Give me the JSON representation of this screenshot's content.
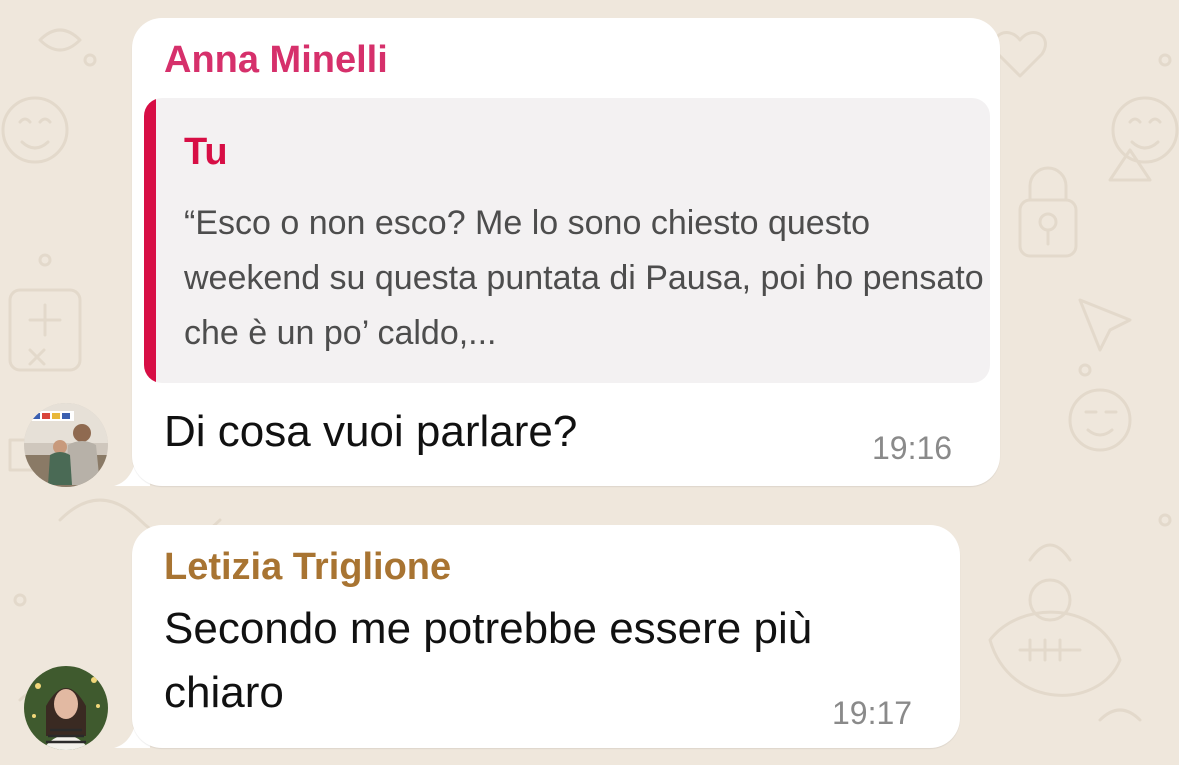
{
  "colors": {
    "background": "#efe7dc",
    "bubble": "#ffffff",
    "sender_anna": "#d6306b",
    "sender_letizia": "#a87432",
    "quote_accent": "#d70e45",
    "quote_background": "#f3f1f2",
    "timestamp": "#8a8a8a"
  },
  "messages": [
    {
      "sender": "Anna Minelli",
      "reply": {
        "author": "Tu",
        "text": "“Esco o non esco? Me lo sono chiesto questo weekend su questa puntata di Pausa, poi ho pensato che è un po’ caldo,..."
      },
      "text": "Di cosa vuoi parlare?",
      "time": "19:16"
    },
    {
      "sender": "Letizia Triglione",
      "text": "Secondo me potrebbe essere più chiaro",
      "time": "19:17"
    }
  ]
}
